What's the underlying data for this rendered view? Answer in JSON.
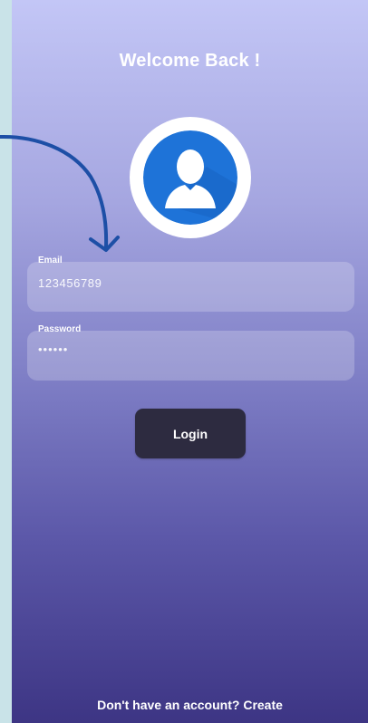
{
  "header": {
    "title": "Welcome Back !"
  },
  "avatar": {
    "icon": "user-icon",
    "ring_color": "#ffffff",
    "fill_color": "#1e73d8"
  },
  "form": {
    "email": {
      "label": "Email",
      "value": "123456789"
    },
    "password": {
      "label": "Password",
      "value": "••••••"
    }
  },
  "login_button": {
    "label": "Login"
  },
  "footer": {
    "prompt": "Don't have an account?",
    "link": "Create"
  },
  "colors": {
    "gradient_top": "#c3c6f6",
    "gradient_bottom": "#3d3584",
    "button_bg": "#2d2b40",
    "annotation_arrow": "#1d4fa6",
    "page_background": "#c9e3e8"
  }
}
